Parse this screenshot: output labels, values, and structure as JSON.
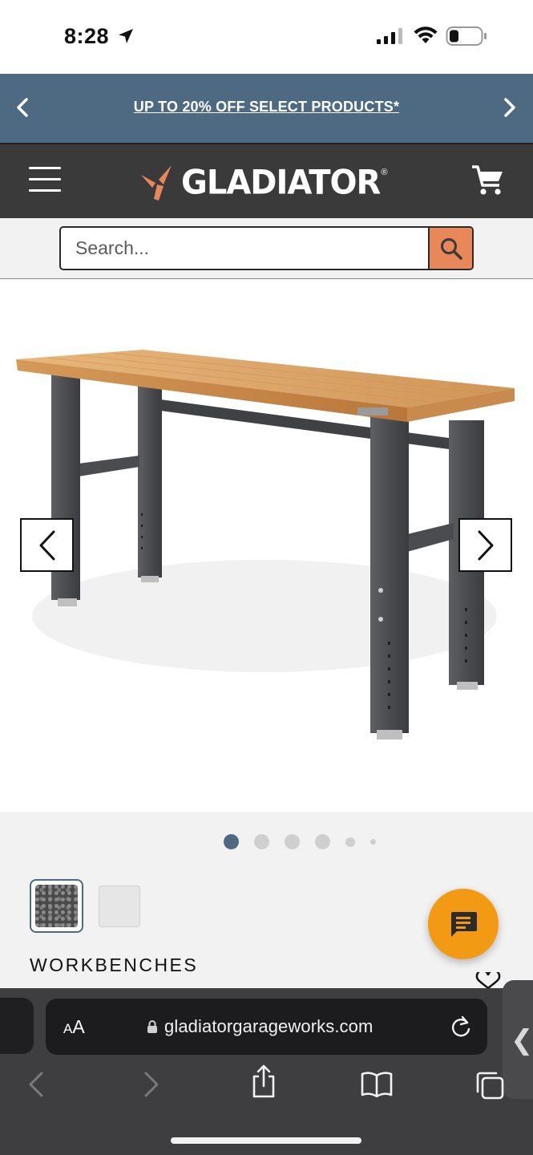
{
  "status_bar": {
    "time": "8:28",
    "icons": [
      "location-arrow-icon",
      "cellular-signal-icon",
      "wifi-icon",
      "battery-icon"
    ]
  },
  "promo_banner": {
    "text": "UP TO 20% OFF SELECT PRODUCTS*",
    "background": "#4e6a83"
  },
  "header": {
    "logo_text": "GLADIATOR",
    "logo_mark": "®",
    "background": "#3a3a3a",
    "accent": "#e8875a"
  },
  "search": {
    "placeholder": "Search...",
    "value": ""
  },
  "product": {
    "image_alt": "Gladiator adjustable height hardwood workbench",
    "carousel": {
      "slide_count": 6,
      "active_index": 0
    },
    "swatches": [
      {
        "name": "hammered granite",
        "color": "#4a4a4a",
        "selected": true
      },
      {
        "name": "white",
        "color": "#e6e6e6",
        "selected": false
      }
    ],
    "category": "WORKBENCHES"
  },
  "chat": {
    "color": "#f39a14"
  },
  "browser": {
    "text_size_label_small": "A",
    "text_size_label_large": "A",
    "url": "gladiatorgarageworks.com",
    "toolbar": [
      "back-icon",
      "forward-icon",
      "share-icon",
      "bookmarks-icon",
      "tabs-icon"
    ]
  }
}
